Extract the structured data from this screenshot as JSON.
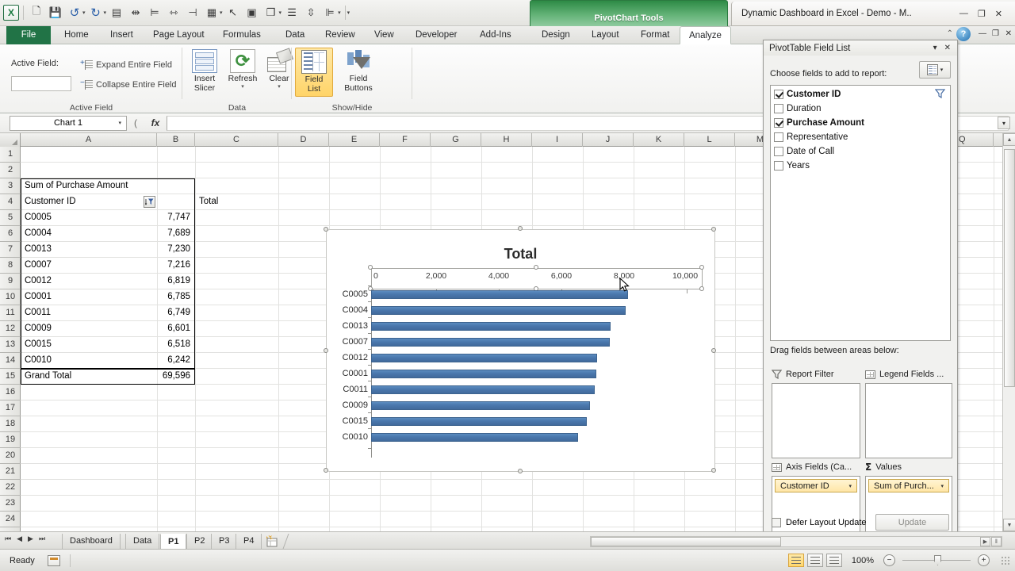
{
  "window": {
    "title": "Dynamic Dashboard in Excel - Demo  - M..",
    "minimize": "—",
    "restore": "❐",
    "close": "✕",
    "inner_minimize": "—",
    "inner_restore": "❐",
    "inner_close": "✕",
    "ribbon_collapse": "⌃",
    "help": "?"
  },
  "quick_access": {
    "excel_badge": "X",
    "items": [
      "new-icon",
      "save-icon",
      "undo-icon",
      "redo-icon",
      "form-icon",
      "center-across-icon",
      "align-left-icon",
      "distribute-icon",
      "align-right-icon",
      "table-icon",
      "select-icon",
      "camera-icon",
      "shapes-icon",
      "justify-icon",
      "merge-icon",
      "order-icon",
      "customize-icon"
    ]
  },
  "contextual_tools": {
    "label": "PivotChart Tools"
  },
  "ribbon": {
    "tabs": [
      "File",
      "Home",
      "Insert",
      "Page Layout",
      "Formulas",
      "Data",
      "Review",
      "View",
      "Developer",
      "Add-Ins"
    ],
    "context_tabs": [
      "Design",
      "Layout",
      "Format",
      "Analyze"
    ],
    "active_tab": "Analyze",
    "groups": [
      {
        "name": "Active Field"
      },
      {
        "name": "Data"
      },
      {
        "name": "Show/Hide"
      }
    ],
    "active_field_label": "Active Field:",
    "active_field_value": "",
    "expand_entire_field": "Expand Entire Field",
    "collapse_entire_field": "Collapse Entire Field",
    "insert_slicer": {
      "l1": "Insert",
      "l2": "Slicer",
      "caret": "▾"
    },
    "refresh": {
      "l1": "Refresh",
      "l2": "",
      "caret": "▾"
    },
    "clear": {
      "l1": "Clear",
      "l2": "",
      "caret": "▾"
    },
    "field_list": {
      "l1": "Field",
      "l2": "List"
    },
    "field_buttons": {
      "l1": "Field",
      "l2": "Buttons",
      "caret": "▾"
    }
  },
  "formula_bar": {
    "name_box": "Chart 1",
    "name_box_caret": "▾",
    "split_caret": "(",
    "fx": "fx",
    "value": "",
    "expand": "▾"
  },
  "grid": {
    "columns": [
      "A",
      "B",
      "C",
      "D",
      "E",
      "F",
      "G",
      "H",
      "I",
      "J",
      "K",
      "L",
      "M",
      "Q"
    ],
    "rows": [
      "1",
      "2",
      "3",
      "4",
      "5",
      "6",
      "7",
      "8",
      "9",
      "10",
      "11",
      "12",
      "13",
      "14",
      "15",
      "16",
      "17",
      "18",
      "19",
      "20",
      "21",
      "22",
      "23",
      "24"
    ],
    "pivot": {
      "title": "Sum of Purchase Amount",
      "header_row_label": "Customer ID",
      "header_value_label": "Total",
      "filter_icon": "sort-filter-icon",
      "rows": [
        {
          "id": "C0005",
          "total": "7,747"
        },
        {
          "id": "C0004",
          "total": "7,689"
        },
        {
          "id": "C0013",
          "total": "7,230"
        },
        {
          "id": "C0007",
          "total": "7,216"
        },
        {
          "id": "C0012",
          "total": "6,819"
        },
        {
          "id": "C0001",
          "total": "6,785"
        },
        {
          "id": "C0011",
          "total": "6,749"
        },
        {
          "id": "C0009",
          "total": "6,601"
        },
        {
          "id": "C0015",
          "total": "6,518"
        },
        {
          "id": "C0010",
          "total": "6,242"
        }
      ],
      "grand_total_label": "Grand Total",
      "grand_total_value": "69,596"
    }
  },
  "chart_data": {
    "type": "bar",
    "title": "Total",
    "orientation": "horizontal",
    "categories": [
      "C0005",
      "C0004",
      "C0013",
      "C0007",
      "C0012",
      "C0001",
      "C0011",
      "C0009",
      "C0015",
      "C0010"
    ],
    "values": [
      7747,
      7689,
      7230,
      7216,
      6819,
      6785,
      6749,
      6601,
      6518,
      6242
    ],
    "series": [
      {
        "name": "Total",
        "values": [
          7747,
          7689,
          7230,
          7216,
          6819,
          6785,
          6749,
          6601,
          6518,
          6242
        ]
      }
    ],
    "xlabel": "",
    "ylabel": "",
    "xlim": [
      0,
      10000
    ],
    "xticks": [
      0,
      2000,
      4000,
      6000,
      8000,
      10000
    ],
    "xticklabels": [
      "0",
      "2,000",
      "4,000",
      "6,000",
      "8,000",
      "10,000"
    ],
    "grid": false,
    "legend": false,
    "axis_position": "top",
    "bar_color": "#4a77ac",
    "selected_element": "horizontal-value-axis"
  },
  "field_list": {
    "title": "PivotTable Field List",
    "title_caret": "▾",
    "title_close": "✕",
    "choose_label": "Choose fields to add to report:",
    "view_button_caret": "▾",
    "filter_icon": "filter-icon",
    "fields": [
      {
        "name": "Customer ID",
        "checked": true,
        "bold": true
      },
      {
        "name": "Duration",
        "checked": false,
        "bold": false
      },
      {
        "name": "Purchase Amount",
        "checked": true,
        "bold": true
      },
      {
        "name": "Representative",
        "checked": false,
        "bold": false
      },
      {
        "name": "Date of Call",
        "checked": false,
        "bold": false
      },
      {
        "name": "Years",
        "checked": false,
        "bold": false
      }
    ],
    "drag_label": "Drag fields between areas below:",
    "zones": [
      {
        "key": "report_filter",
        "label": "Report Filter",
        "icon": "filter-icon",
        "pill": null
      },
      {
        "key": "legend_fields",
        "label": "Legend Fields ...",
        "icon": "grid-icon",
        "pill": null
      },
      {
        "key": "axis_fields",
        "label": "Axis Fields (Ca...",
        "icon": "grid-icon",
        "pill": "Customer ID"
      },
      {
        "key": "values",
        "label": "Values",
        "icon": "sigma-icon",
        "pill": "Sum of Purch..."
      }
    ],
    "pill_caret": "▾",
    "defer_label": "Defer Layout Update",
    "defer_checked": false,
    "update_button": "Update"
  },
  "sheet_tabs": {
    "nav": [
      "⏮",
      "◀",
      "▶",
      "⏭"
    ],
    "tabs": [
      {
        "label": "Dashboard",
        "active": false
      },
      {
        "label": "Data",
        "active": false
      },
      {
        "label": "P1",
        "active": true
      },
      {
        "label": "P2",
        "active": false
      },
      {
        "label": "P3",
        "active": false
      },
      {
        "label": "P4",
        "active": false
      }
    ],
    "new_sheet_icon": "new-sheet-icon"
  },
  "status_bar": {
    "ready": "Ready",
    "macro_icon": "record-macro-icon",
    "views": [
      "normal-view-icon",
      "page-layout-view-icon",
      "page-break-view-icon"
    ],
    "active_view": "normal-view-icon",
    "zoom": "100%",
    "zoom_out": "−",
    "zoom_in": "+"
  }
}
